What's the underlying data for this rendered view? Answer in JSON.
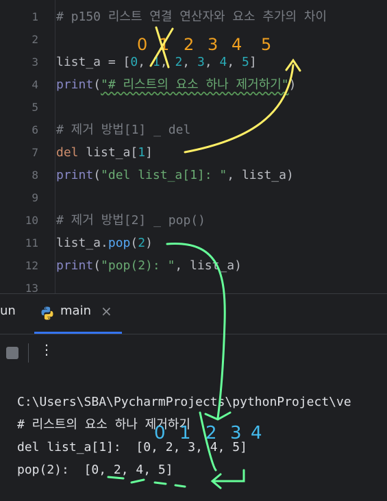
{
  "editor": {
    "line_numbers": [
      "1",
      "2",
      "3",
      "4",
      "5",
      "6",
      "7",
      "8",
      "9",
      "10",
      "11",
      "12",
      "13"
    ],
    "line1_comment": "# p150 리스트 연결 연산자와 요소 추가의 차이",
    "line3_code": "list_a = [",
    "line3_vals": [
      "0",
      "1",
      "2",
      "3",
      "4",
      "5"
    ],
    "line3_close": "]",
    "line4_print": "print",
    "line4_str": "\"# 리스트의 요소 하나 제거하기\"",
    "line6_comment": "# 제거 방법[1] _ del",
    "line7_kw": "del",
    "line7_var": " list_a[",
    "line7_idx": "1",
    "line7_close": "]",
    "line8_print": "print",
    "line8_str": "\"del list_a[1]: \"",
    "line8_rest": ", list_a)",
    "line10_comment": "# 제거 방법[2] _ pop()",
    "line11_code": "list_a.",
    "line11_fn": "pop",
    "line11_arg": "2",
    "line12_print": "print",
    "line12_str": "\"pop(2): \"",
    "line12_rest": ", list_a)"
  },
  "run_panel": {
    "tab_run_label": "un",
    "tab_main_label": "main",
    "tab_close": "×",
    "more_icon": "⋮",
    "output_lines": [
      "C:\\Users\\SBA\\PycharmProjects\\pythonProject\\ve",
      "# 리스트의 요소 하나 제거하기",
      "del list_a[1]:  [0, 2, 3, 4, 5]",
      "pop(2):  [0, 2, 4, 5]"
    ]
  },
  "annotations": {
    "top_digits": [
      "0",
      "1",
      "2",
      "3",
      "4",
      "5"
    ],
    "bottom_digits": [
      "0",
      "1",
      "2",
      "3",
      "4"
    ],
    "colors": {
      "orange": "#f0a020",
      "yellow": "#ffee66",
      "green": "#66ff99",
      "blue": "#44bbee"
    }
  }
}
